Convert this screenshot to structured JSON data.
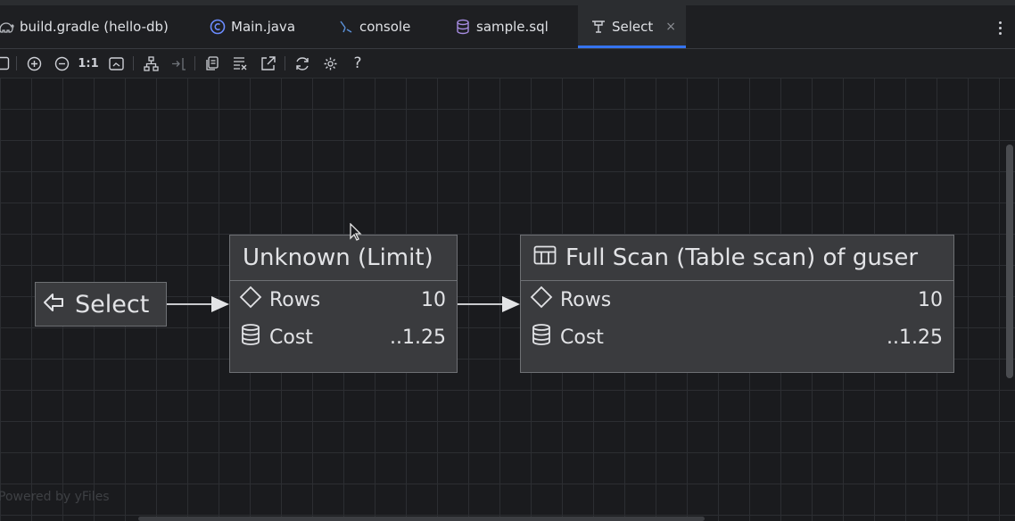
{
  "tabs": [
    {
      "label": "build.gradle (hello-db)",
      "icon": "gradle-elephant-icon"
    },
    {
      "label": "Main.java",
      "icon": "java-class-icon"
    },
    {
      "label": "console",
      "icon": "console-icon"
    },
    {
      "label": "sample.sql",
      "icon": "database-file-icon"
    },
    {
      "label": "Select",
      "icon": "query-plan-icon",
      "active": true,
      "close": "×"
    }
  ],
  "toolbar": {
    "actual_size_label": "1:1",
    "help_label": "?",
    "icons": [
      "frame-icon",
      "zoom-in-icon",
      "zoom-out-icon",
      "actual-size-icon",
      "fit-content-icon",
      "layout-icon",
      "collapse-icon",
      "copy-icon",
      "properties-icon",
      "export-icon",
      "refresh-icon",
      "settings-icon",
      "help-icon"
    ]
  },
  "diagram": {
    "select_node": {
      "label": "Select",
      "icon": "arrow-left-icon"
    },
    "limit_node": {
      "title": "Unknown (Limit)",
      "rows_label": "Rows",
      "rows_value": "10",
      "cost_label": "Cost",
      "cost_value": "..1.25"
    },
    "scan_node": {
      "title": "Full Scan (Table scan) of guser",
      "title_icon": "table-icon",
      "rows_label": "Rows",
      "rows_value": "10",
      "cost_label": "Cost",
      "cost_value": "..1.25"
    },
    "watermark": "Powered by yFiles"
  },
  "colors": {
    "background": "#1e1f22",
    "accent": "#3574f0",
    "node_fill": "#3a3b3e",
    "node_border": "#6e7074"
  }
}
